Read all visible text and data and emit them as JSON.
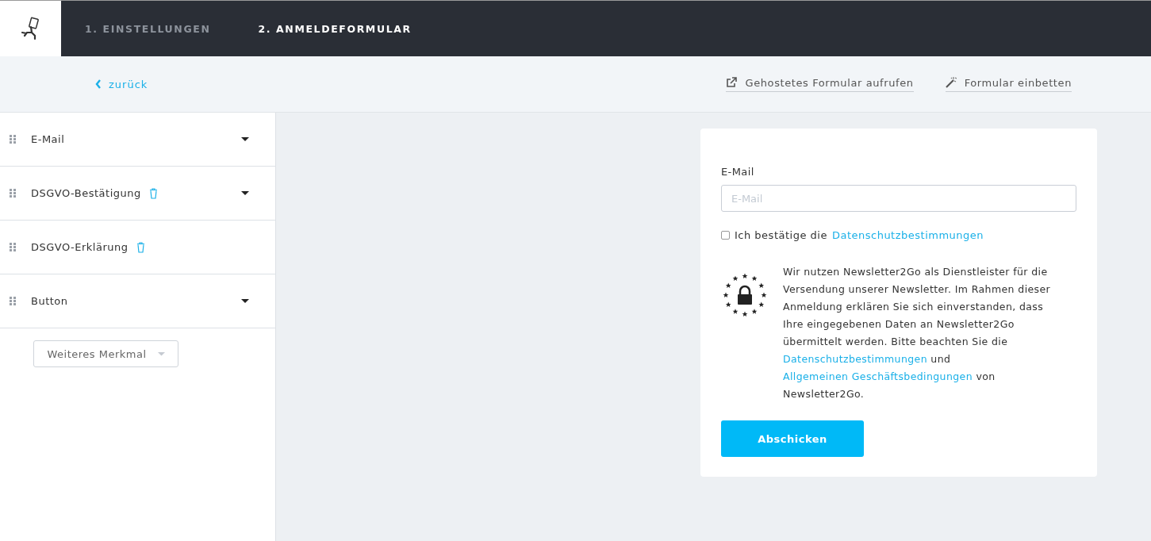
{
  "steps": [
    {
      "label": "1. EINSTELLUNGEN",
      "selected": false
    },
    {
      "label": "2. ANMELDEFORMULAR",
      "selected": true
    }
  ],
  "back_link": "zurück",
  "actions": [
    {
      "label": "Gehostetes Formular aufrufen",
      "kind": "external"
    },
    {
      "label": "Formular einbetten",
      "kind": "wand"
    }
  ],
  "fields": [
    {
      "label": "E-Mail",
      "expandable": true,
      "deletable": false
    },
    {
      "label": "DSGVO-Bestätigung",
      "expandable": true,
      "deletable": true
    },
    {
      "label": "DSGVO-Erklärung",
      "expandable": false,
      "deletable": true
    },
    {
      "label": "Button",
      "expandable": true,
      "deletable": false
    }
  ],
  "add_field": "Weiteres Merkmal",
  "form": {
    "email_label": "E-Mail",
    "email_placeholder": "E-Mail",
    "consent": {
      "checked": false,
      "text": "Ich bestätige die",
      "link": "Datenschutzbestimmungen"
    },
    "notice": [
      {
        "kind": "text",
        "text": "Wir nutzen Newsletter2Go als Dienstleister für die Versendung unserer Newsletter. Im Rahmen dieser Anmeldung erklären Sie sich einverstanden, dass Ihre eingegebenen Daten an Newsletter2Go übermittelt werden. Bitte beachten Sie die"
      },
      {
        "kind": "link",
        "text": "Datenschutzbestimmungen"
      },
      {
        "kind": "text",
        "text": "und"
      },
      {
        "kind": "link",
        "text": "Allgemeinen Geschäftsbedingungen"
      },
      {
        "kind": "text",
        "text": "von Newsletter2Go."
      }
    ],
    "submit": "Abschicken"
  }
}
